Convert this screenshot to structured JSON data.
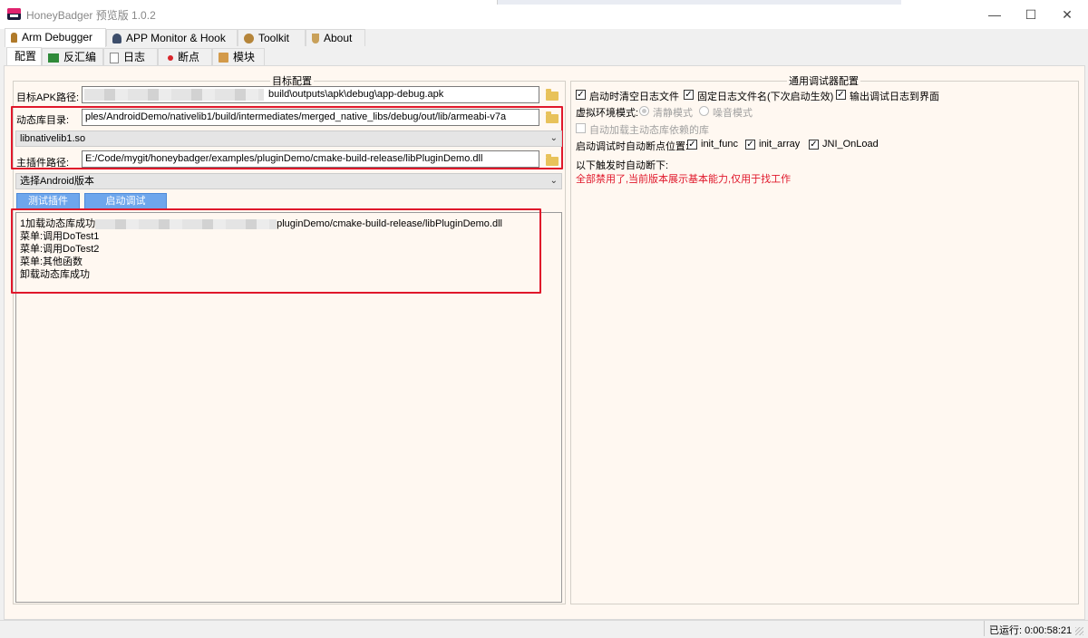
{
  "window": {
    "title": "HoneyBadger 预览版 1.0.2",
    "minimize": "—",
    "maximize": "☐",
    "close": "✕"
  },
  "main_tabs": [
    {
      "label": "Arm Debugger",
      "icon": "arm-icon"
    },
    {
      "label": "APP Monitor & Hook",
      "icon": "monitor-icon"
    },
    {
      "label": "Toolkit",
      "icon": "toolkit-icon"
    },
    {
      "label": "About",
      "icon": "about-icon"
    }
  ],
  "sub_tabs": [
    {
      "label": "配置"
    },
    {
      "label": "反汇编",
      "icon": "disasm-icon"
    },
    {
      "label": "日志",
      "icon": "log-icon"
    },
    {
      "label": "断点",
      "icon": "breakpoint-icon"
    },
    {
      "label": "模块",
      "icon": "module-icon"
    }
  ],
  "target_config": {
    "title": "目标配置",
    "apk_label": "目标APK路径:",
    "apk_value_visible": "build\\outputs\\apk\\debug\\app-debug.apk",
    "libdir_label": "动态库目录:",
    "libdir_value": "ples/AndroidDemo/nativelib1/build/intermediates/merged_native_libs/debug/out/lib/armeabi-v7a",
    "lib_select": "libnativelib1.so",
    "plugin_label": "主插件路径:",
    "plugin_value": "E:/Code/mygit/honeybadger/examples/pluginDemo/cmake-build-release/libPluginDemo.dll",
    "android_select": "选择Android版本",
    "test_plugin_btn": "测试插件",
    "start_debug_btn": "启动调试",
    "log_lines": {
      "l1_prefix": "1加载动态库成功",
      "l1_suffix": "pluginDemo/cmake-build-release/libPluginDemo.dll",
      "l2": "菜单:调用DoTest1",
      "l3": "菜单:调用DoTest2",
      "l4": "菜单:其他函数",
      "l5": "卸载动态库成功"
    }
  },
  "debugger_config": {
    "title": "通用调试器配置",
    "cb_clear_log": "启动时清空日志文件",
    "cb_fixed_log": "固定日志文件名(下次启动生效)",
    "cb_output_log": "输出调试日志到界面",
    "vm_mode_label": "虚拟环境模式:",
    "vm_quiet": "清静模式",
    "vm_noise": "噪音模式",
    "cb_auto_load": "自动加载主动态库依赖的库",
    "bp_label": "启动调试时自动断点位置:",
    "bp_init_func": "init_func",
    "bp_init_array": "init_array",
    "bp_jni_onload": "JNI_OnLoad",
    "trigger_label": "以下触发时自动断下:",
    "warning": "全部禁用了,当前版本展示基本能力,仅用于找工作",
    "check_mark": "✓"
  },
  "status": {
    "running": "已运行: 0:00:58:21"
  },
  "colors": {
    "content_bg": "#fff8f1",
    "accent_red": "#e0182b",
    "button_blue": "#6ea6ec"
  }
}
